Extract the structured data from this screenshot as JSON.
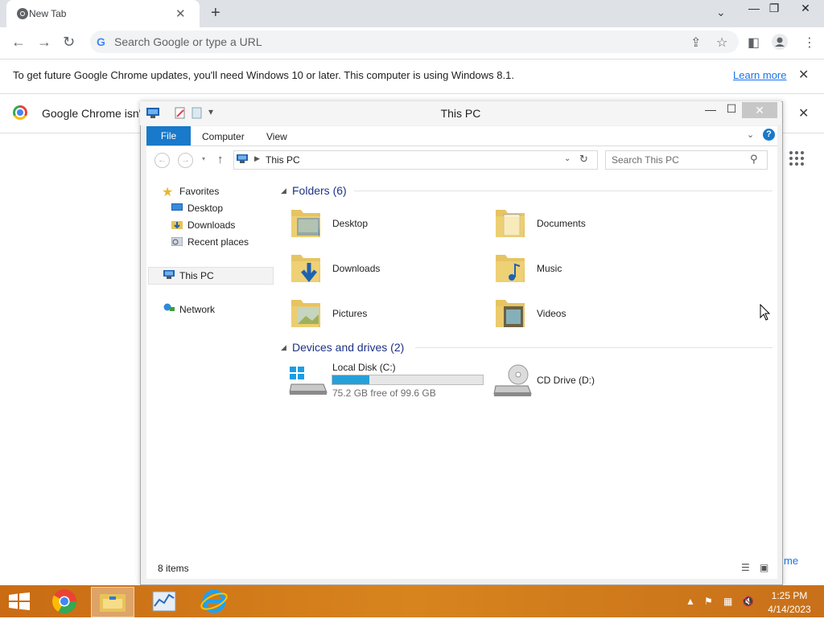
{
  "chrome": {
    "tab_title": "New Tab",
    "omnibox_placeholder": "Search Google or type a URL",
    "infobar_text": "To get future Google Chrome updates, you'll need Windows 10 or later. This computer is using Windows 8.1.",
    "learn_more": "Learn more",
    "default_browser_text": "Google Chrome isn't",
    "customize_fragment": "me"
  },
  "explorer": {
    "title": "This PC",
    "ribbon_tabs": [
      "File",
      "Computer",
      "View"
    ],
    "address_location": "This PC",
    "search_placeholder": "Search This PC",
    "nav_pane": {
      "favorites": "Favorites",
      "favorite_items": [
        "Desktop",
        "Downloads",
        "Recent places"
      ],
      "this_pc": "This PC",
      "network": "Network"
    },
    "folders_header": "Folders (6)",
    "folders": [
      "Desktop",
      "Documents",
      "Downloads",
      "Music",
      "Pictures",
      "Videos"
    ],
    "devices_header": "Devices and drives (2)",
    "drives": [
      {
        "name": "Local Disk (C:)",
        "free_text": "75.2 GB free of 99.6 GB",
        "used_fraction": 0.245
      },
      {
        "name": "CD Drive (D:)"
      }
    ],
    "status": "8 items"
  },
  "taskbar": {
    "time": "1:25 PM",
    "date": "4/14/2023"
  },
  "colors": {
    "accent": "#1979ca",
    "taskbar": "#d07a1a",
    "link": "#1a73e8"
  }
}
